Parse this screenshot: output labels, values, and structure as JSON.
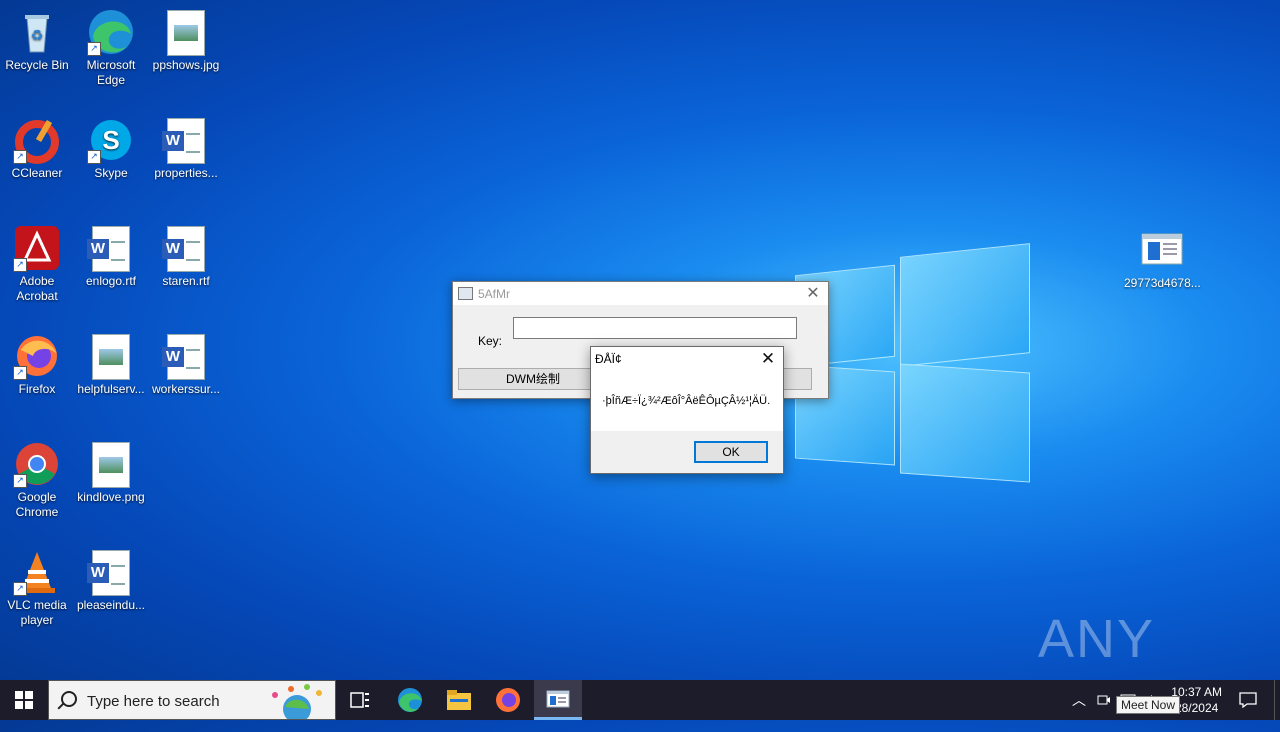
{
  "desktop": {
    "icons": [
      {
        "label": "Recycle Bin",
        "icon": "recycle-bin-icon"
      },
      {
        "label": "Microsoft Edge",
        "icon": "edge-icon"
      },
      {
        "label": "ppshows.jpg",
        "icon": "image-file-icon"
      },
      {
        "label": "CCleaner",
        "icon": "ccleaner-icon"
      },
      {
        "label": "Skype",
        "icon": "skype-icon"
      },
      {
        "label": "properties...",
        "icon": "word-doc-icon"
      },
      {
        "label": "Adobe Acrobat",
        "icon": "acrobat-icon"
      },
      {
        "label": "enlogo.rtf",
        "icon": "word-doc-icon"
      },
      {
        "label": "staren.rtf",
        "icon": "word-doc-icon"
      },
      {
        "label": "Firefox",
        "icon": "firefox-icon"
      },
      {
        "label": "helpfulserv...",
        "icon": "image-file-icon"
      },
      {
        "label": "workerssur...",
        "icon": "word-doc-icon"
      },
      {
        "label": "Google Chrome",
        "icon": "chrome-icon"
      },
      {
        "label": "kindlove.png",
        "icon": "image-file-icon"
      },
      {
        "label": "VLC media player",
        "icon": "vlc-icon"
      },
      {
        "label": "pleaseindu...",
        "icon": "word-doc-icon"
      },
      {
        "label": "29773d4678...",
        "icon": "exe-file-icon"
      }
    ]
  },
  "app_window": {
    "title": "5AfMr",
    "key_label": "Key:",
    "key_value": "",
    "dwm_button": "DWM绘制"
  },
  "dialog": {
    "title": "ÐÅÏ¢",
    "message": "·þÎñÆ÷Ï¿¾²ÆôÎ°ÂëÊÔµÇÂ½¹¦ÄÜ.",
    "ok_label": "OK"
  },
  "taskbar": {
    "search_placeholder": "Type here to search",
    "time": "10:37 AM",
    "date": "28/2024",
    "tooltip": "Meet Now"
  },
  "watermark": "ANY RUN",
  "colors": {
    "taskbar": "#1c1c2a",
    "accent": "#0078d7",
    "desktop_blue": "#0a64d8"
  }
}
